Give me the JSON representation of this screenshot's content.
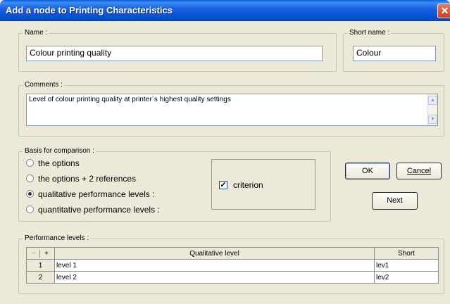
{
  "window": {
    "title": "Add a node to Printing Characteristics",
    "close_glyph": "✕"
  },
  "name": {
    "label": "Name :",
    "value": "Colour printing quality"
  },
  "short_name": {
    "label": "Short name :",
    "value": "Colour"
  },
  "comments": {
    "label": "Comments :",
    "value": "Level of colour printing quality at printer`s highest quality settings",
    "scroll_up": "▲",
    "scroll_down": "▼"
  },
  "basis": {
    "label": "Basis for comparison :",
    "options": [
      {
        "label": "the options",
        "selected": false
      },
      {
        "label": "the options + 2 references",
        "selected": false
      },
      {
        "label": "qualitative performance levels :",
        "selected": true
      },
      {
        "label": "quantitative performance levels :",
        "selected": false
      }
    ],
    "criterion": {
      "label": "criterion",
      "checked": true,
      "check_glyph": "✓"
    }
  },
  "buttons": {
    "ok": "OK",
    "cancel": "Cancel",
    "next": "Next"
  },
  "performance_levels": {
    "label": "Performance levels :",
    "remove_glyph": "−",
    "add_glyph": "+",
    "columns": [
      "Qualitative level",
      "Short"
    ],
    "rows": [
      {
        "index": "1",
        "level": "level 1",
        "short": "lev1"
      },
      {
        "index": "2",
        "level": "level 2",
        "short": "lev2"
      }
    ]
  }
}
